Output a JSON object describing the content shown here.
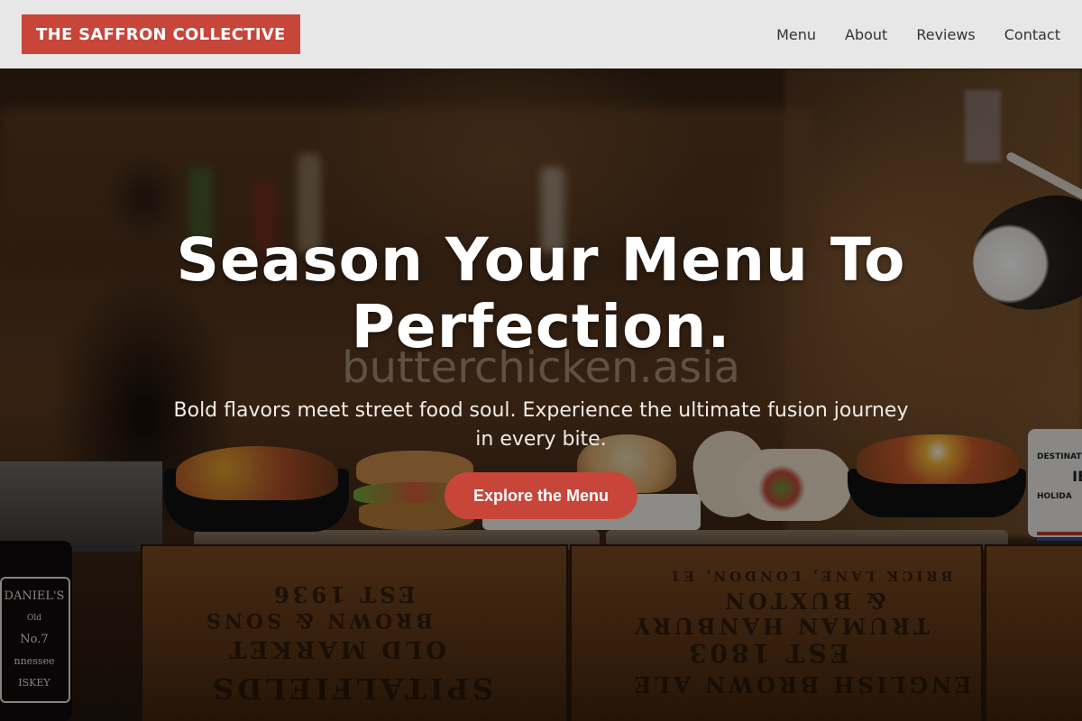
{
  "brand": {
    "name": "THE SAFFRON COLLECTIVE"
  },
  "nav": {
    "items": [
      {
        "label": "Menu"
      },
      {
        "label": "About"
      },
      {
        "label": "Reviews"
      },
      {
        "label": "Contact"
      }
    ]
  },
  "hero": {
    "headline": "Season Your Menu To Perfection.",
    "watermark": "butterchicken.asia",
    "subtitle": "Bold flavors meet street food soul. Experience the ultimate fusion journey in every bite.",
    "cta_label": "Explore the Menu"
  },
  "background_photo": {
    "crate_left_text": [
      "EST 1936",
      "BROWN & SONS",
      "OLD MARKET",
      "SPITALFIELDS"
    ],
    "crate_right_text": [
      "BRICK LANE, LONDON, E1",
      "& BUXTON",
      "TRUMAN HANBURY",
      "EST 1803",
      "ENGLISH BROWN ALE"
    ],
    "bottle_label": [
      "DANIEL'S",
      "Old",
      "No.7",
      "nnessee",
      "ISKEY"
    ],
    "mug_label": [
      "DESTINAT",
      "IE",
      "HOLIDA"
    ]
  },
  "colors": {
    "accent": "#c8453a",
    "nav_background": "#f0f0f0",
    "nav_text": "#333333"
  }
}
